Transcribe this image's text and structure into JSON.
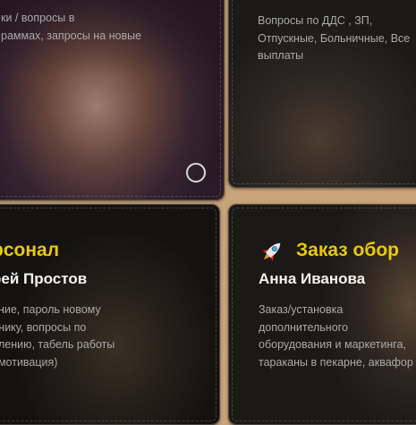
{
  "cards": {
    "top_left": {
      "desc_lines": [
        "ки / вопросы в",
        "раммах, запросы на новые"
      ]
    },
    "top_right": {
      "desc_lines": [
        "Вопросы по ДДС , ЗП,",
        "Отпускные, Больничные, Все",
        "выплаты"
      ]
    },
    "bottom_left": {
      "title": "рсонал",
      "person": "рей Простов",
      "desc_lines": [
        "ение, пароль новому",
        "днику, вопросы по",
        "илению, табель работы",
        ", мотивация)"
      ]
    },
    "bottom_right": {
      "icon": "rocket-icon",
      "title": "Заказ обор",
      "person": "Анна Иванова",
      "desc_lines": [
        "Заказ/установка",
        "дополнительного",
        "оборудования и маркетинга,",
        "тараканы в пекарне, аквафор"
      ]
    }
  },
  "colors": {
    "accent_title": "#e8c90d",
    "page_bg": "#c9a37a"
  }
}
